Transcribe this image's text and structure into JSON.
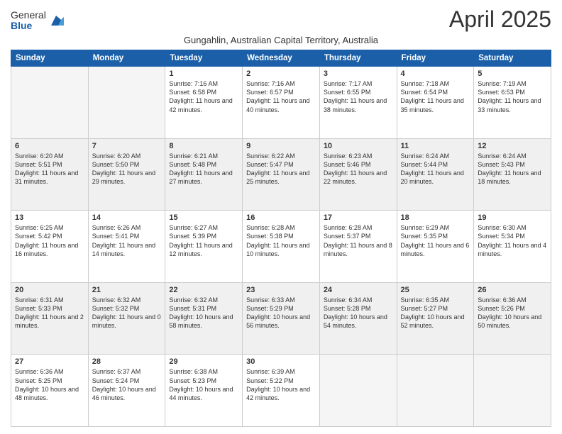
{
  "logo": {
    "general": "General",
    "blue": "Blue"
  },
  "title": "April 2025",
  "subtitle": "Gungahlin, Australian Capital Territory, Australia",
  "days_header": [
    "Sunday",
    "Monday",
    "Tuesday",
    "Wednesday",
    "Thursday",
    "Friday",
    "Saturday"
  ],
  "weeks": [
    [
      {
        "day": "",
        "sunrise": "",
        "sunset": "",
        "daylight": "",
        "empty": true
      },
      {
        "day": "",
        "sunrise": "",
        "sunset": "",
        "daylight": "",
        "empty": true
      },
      {
        "day": "1",
        "sunrise": "Sunrise: 7:16 AM",
        "sunset": "Sunset: 6:58 PM",
        "daylight": "Daylight: 11 hours and 42 minutes."
      },
      {
        "day": "2",
        "sunrise": "Sunrise: 7:16 AM",
        "sunset": "Sunset: 6:57 PM",
        "daylight": "Daylight: 11 hours and 40 minutes."
      },
      {
        "day": "3",
        "sunrise": "Sunrise: 7:17 AM",
        "sunset": "Sunset: 6:55 PM",
        "daylight": "Daylight: 11 hours and 38 minutes."
      },
      {
        "day": "4",
        "sunrise": "Sunrise: 7:18 AM",
        "sunset": "Sunset: 6:54 PM",
        "daylight": "Daylight: 11 hours and 35 minutes."
      },
      {
        "day": "5",
        "sunrise": "Sunrise: 7:19 AM",
        "sunset": "Sunset: 6:53 PM",
        "daylight": "Daylight: 11 hours and 33 minutes."
      }
    ],
    [
      {
        "day": "6",
        "sunrise": "Sunrise: 6:20 AM",
        "sunset": "Sunset: 5:51 PM",
        "daylight": "Daylight: 11 hours and 31 minutes."
      },
      {
        "day": "7",
        "sunrise": "Sunrise: 6:20 AM",
        "sunset": "Sunset: 5:50 PM",
        "daylight": "Daylight: 11 hours and 29 minutes."
      },
      {
        "day": "8",
        "sunrise": "Sunrise: 6:21 AM",
        "sunset": "Sunset: 5:48 PM",
        "daylight": "Daylight: 11 hours and 27 minutes."
      },
      {
        "day": "9",
        "sunrise": "Sunrise: 6:22 AM",
        "sunset": "Sunset: 5:47 PM",
        "daylight": "Daylight: 11 hours and 25 minutes."
      },
      {
        "day": "10",
        "sunrise": "Sunrise: 6:23 AM",
        "sunset": "Sunset: 5:46 PM",
        "daylight": "Daylight: 11 hours and 22 minutes."
      },
      {
        "day": "11",
        "sunrise": "Sunrise: 6:24 AM",
        "sunset": "Sunset: 5:44 PM",
        "daylight": "Daylight: 11 hours and 20 minutes."
      },
      {
        "day": "12",
        "sunrise": "Sunrise: 6:24 AM",
        "sunset": "Sunset: 5:43 PM",
        "daylight": "Daylight: 11 hours and 18 minutes."
      }
    ],
    [
      {
        "day": "13",
        "sunrise": "Sunrise: 6:25 AM",
        "sunset": "Sunset: 5:42 PM",
        "daylight": "Daylight: 11 hours and 16 minutes."
      },
      {
        "day": "14",
        "sunrise": "Sunrise: 6:26 AM",
        "sunset": "Sunset: 5:41 PM",
        "daylight": "Daylight: 11 hours and 14 minutes."
      },
      {
        "day": "15",
        "sunrise": "Sunrise: 6:27 AM",
        "sunset": "Sunset: 5:39 PM",
        "daylight": "Daylight: 11 hours and 12 minutes."
      },
      {
        "day": "16",
        "sunrise": "Sunrise: 6:28 AM",
        "sunset": "Sunset: 5:38 PM",
        "daylight": "Daylight: 11 hours and 10 minutes."
      },
      {
        "day": "17",
        "sunrise": "Sunrise: 6:28 AM",
        "sunset": "Sunset: 5:37 PM",
        "daylight": "Daylight: 11 hours and 8 minutes."
      },
      {
        "day": "18",
        "sunrise": "Sunrise: 6:29 AM",
        "sunset": "Sunset: 5:35 PM",
        "daylight": "Daylight: 11 hours and 6 minutes."
      },
      {
        "day": "19",
        "sunrise": "Sunrise: 6:30 AM",
        "sunset": "Sunset: 5:34 PM",
        "daylight": "Daylight: 11 hours and 4 minutes."
      }
    ],
    [
      {
        "day": "20",
        "sunrise": "Sunrise: 6:31 AM",
        "sunset": "Sunset: 5:33 PM",
        "daylight": "Daylight: 11 hours and 2 minutes."
      },
      {
        "day": "21",
        "sunrise": "Sunrise: 6:32 AM",
        "sunset": "Sunset: 5:32 PM",
        "daylight": "Daylight: 11 hours and 0 minutes."
      },
      {
        "day": "22",
        "sunrise": "Sunrise: 6:32 AM",
        "sunset": "Sunset: 5:31 PM",
        "daylight": "Daylight: 10 hours and 58 minutes."
      },
      {
        "day": "23",
        "sunrise": "Sunrise: 6:33 AM",
        "sunset": "Sunset: 5:29 PM",
        "daylight": "Daylight: 10 hours and 56 minutes."
      },
      {
        "day": "24",
        "sunrise": "Sunrise: 6:34 AM",
        "sunset": "Sunset: 5:28 PM",
        "daylight": "Daylight: 10 hours and 54 minutes."
      },
      {
        "day": "25",
        "sunrise": "Sunrise: 6:35 AM",
        "sunset": "Sunset: 5:27 PM",
        "daylight": "Daylight: 10 hours and 52 minutes."
      },
      {
        "day": "26",
        "sunrise": "Sunrise: 6:36 AM",
        "sunset": "Sunset: 5:26 PM",
        "daylight": "Daylight: 10 hours and 50 minutes."
      }
    ],
    [
      {
        "day": "27",
        "sunrise": "Sunrise: 6:36 AM",
        "sunset": "Sunset: 5:25 PM",
        "daylight": "Daylight: 10 hours and 48 minutes."
      },
      {
        "day": "28",
        "sunrise": "Sunrise: 6:37 AM",
        "sunset": "Sunset: 5:24 PM",
        "daylight": "Daylight: 10 hours and 46 minutes."
      },
      {
        "day": "29",
        "sunrise": "Sunrise: 6:38 AM",
        "sunset": "Sunset: 5:23 PM",
        "daylight": "Daylight: 10 hours and 44 minutes."
      },
      {
        "day": "30",
        "sunrise": "Sunrise: 6:39 AM",
        "sunset": "Sunset: 5:22 PM",
        "daylight": "Daylight: 10 hours and 42 minutes."
      },
      {
        "day": "",
        "sunrise": "",
        "sunset": "",
        "daylight": "",
        "empty": true
      },
      {
        "day": "",
        "sunrise": "",
        "sunset": "",
        "daylight": "",
        "empty": true
      },
      {
        "day": "",
        "sunrise": "",
        "sunset": "",
        "daylight": "",
        "empty": true
      }
    ]
  ]
}
